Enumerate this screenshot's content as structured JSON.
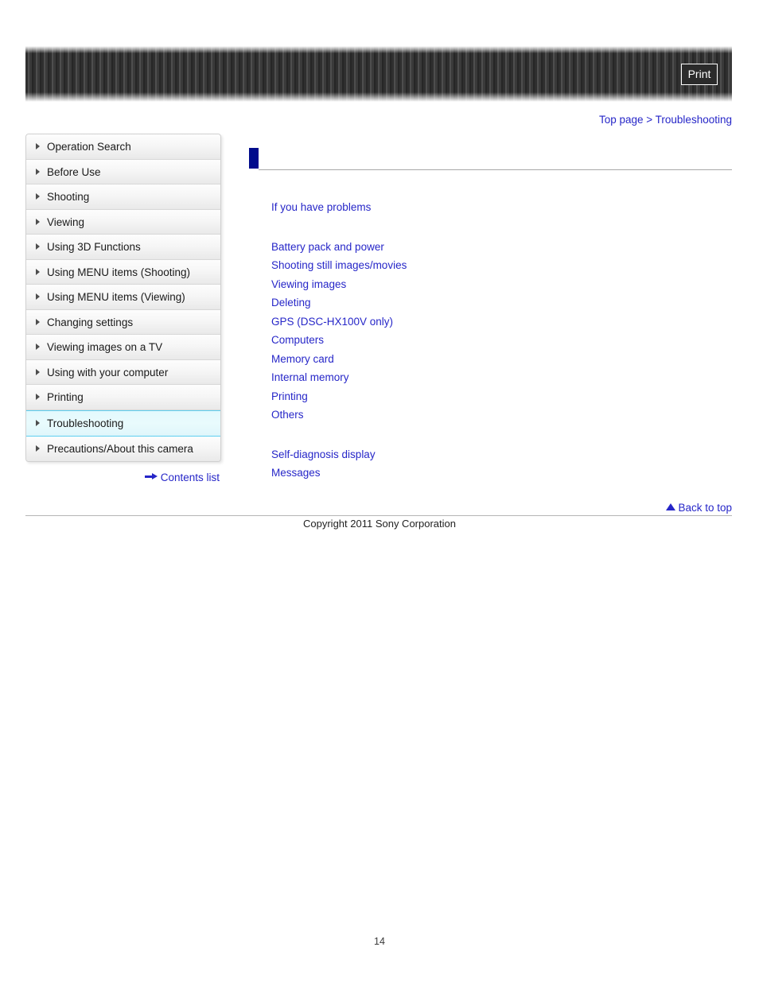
{
  "header": {
    "print_label": "Print",
    "banner_name": "striped-banner"
  },
  "breadcrumb": {
    "top_page": "Top page",
    "separator": ">",
    "current": "Troubleshooting"
  },
  "sidebar": {
    "items": [
      {
        "label": "Operation Search",
        "active": false
      },
      {
        "label": "Before Use",
        "active": false
      },
      {
        "label": "Shooting",
        "active": false
      },
      {
        "label": "Viewing",
        "active": false
      },
      {
        "label": "Using 3D Functions",
        "active": false
      },
      {
        "label": "Using MENU items (Shooting)",
        "active": false
      },
      {
        "label": "Using MENU items (Viewing)",
        "active": false
      },
      {
        "label": "Changing settings",
        "active": false
      },
      {
        "label": "Viewing images on a TV",
        "active": false
      },
      {
        "label": "Using with your computer",
        "active": false
      },
      {
        "label": "Printing",
        "active": false
      },
      {
        "label": "Troubleshooting",
        "active": true
      },
      {
        "label": "Precautions/About this camera",
        "active": false
      }
    ],
    "contents_list_label": "Contents list"
  },
  "main": {
    "page_title": "",
    "intro_link": "If you have problems",
    "topic_links": [
      "Battery pack and power",
      "Shooting still images/movies",
      "Viewing images",
      "Deleting",
      "GPS (DSC-HX100V only)",
      "Computers",
      "Memory card",
      "Internal memory",
      "Printing",
      "Others"
    ],
    "extra_links": [
      "Self-diagnosis display",
      "Messages"
    ]
  },
  "footer": {
    "back_to_top": "Back to top",
    "copyright": "Copyright 2011 Sony Corporation",
    "page_number": "14"
  },
  "colors": {
    "link": "#2626c8",
    "title_marker": "#000b8c",
    "active_border": "#5ecff0",
    "active_bg": "#e3f9fd"
  }
}
